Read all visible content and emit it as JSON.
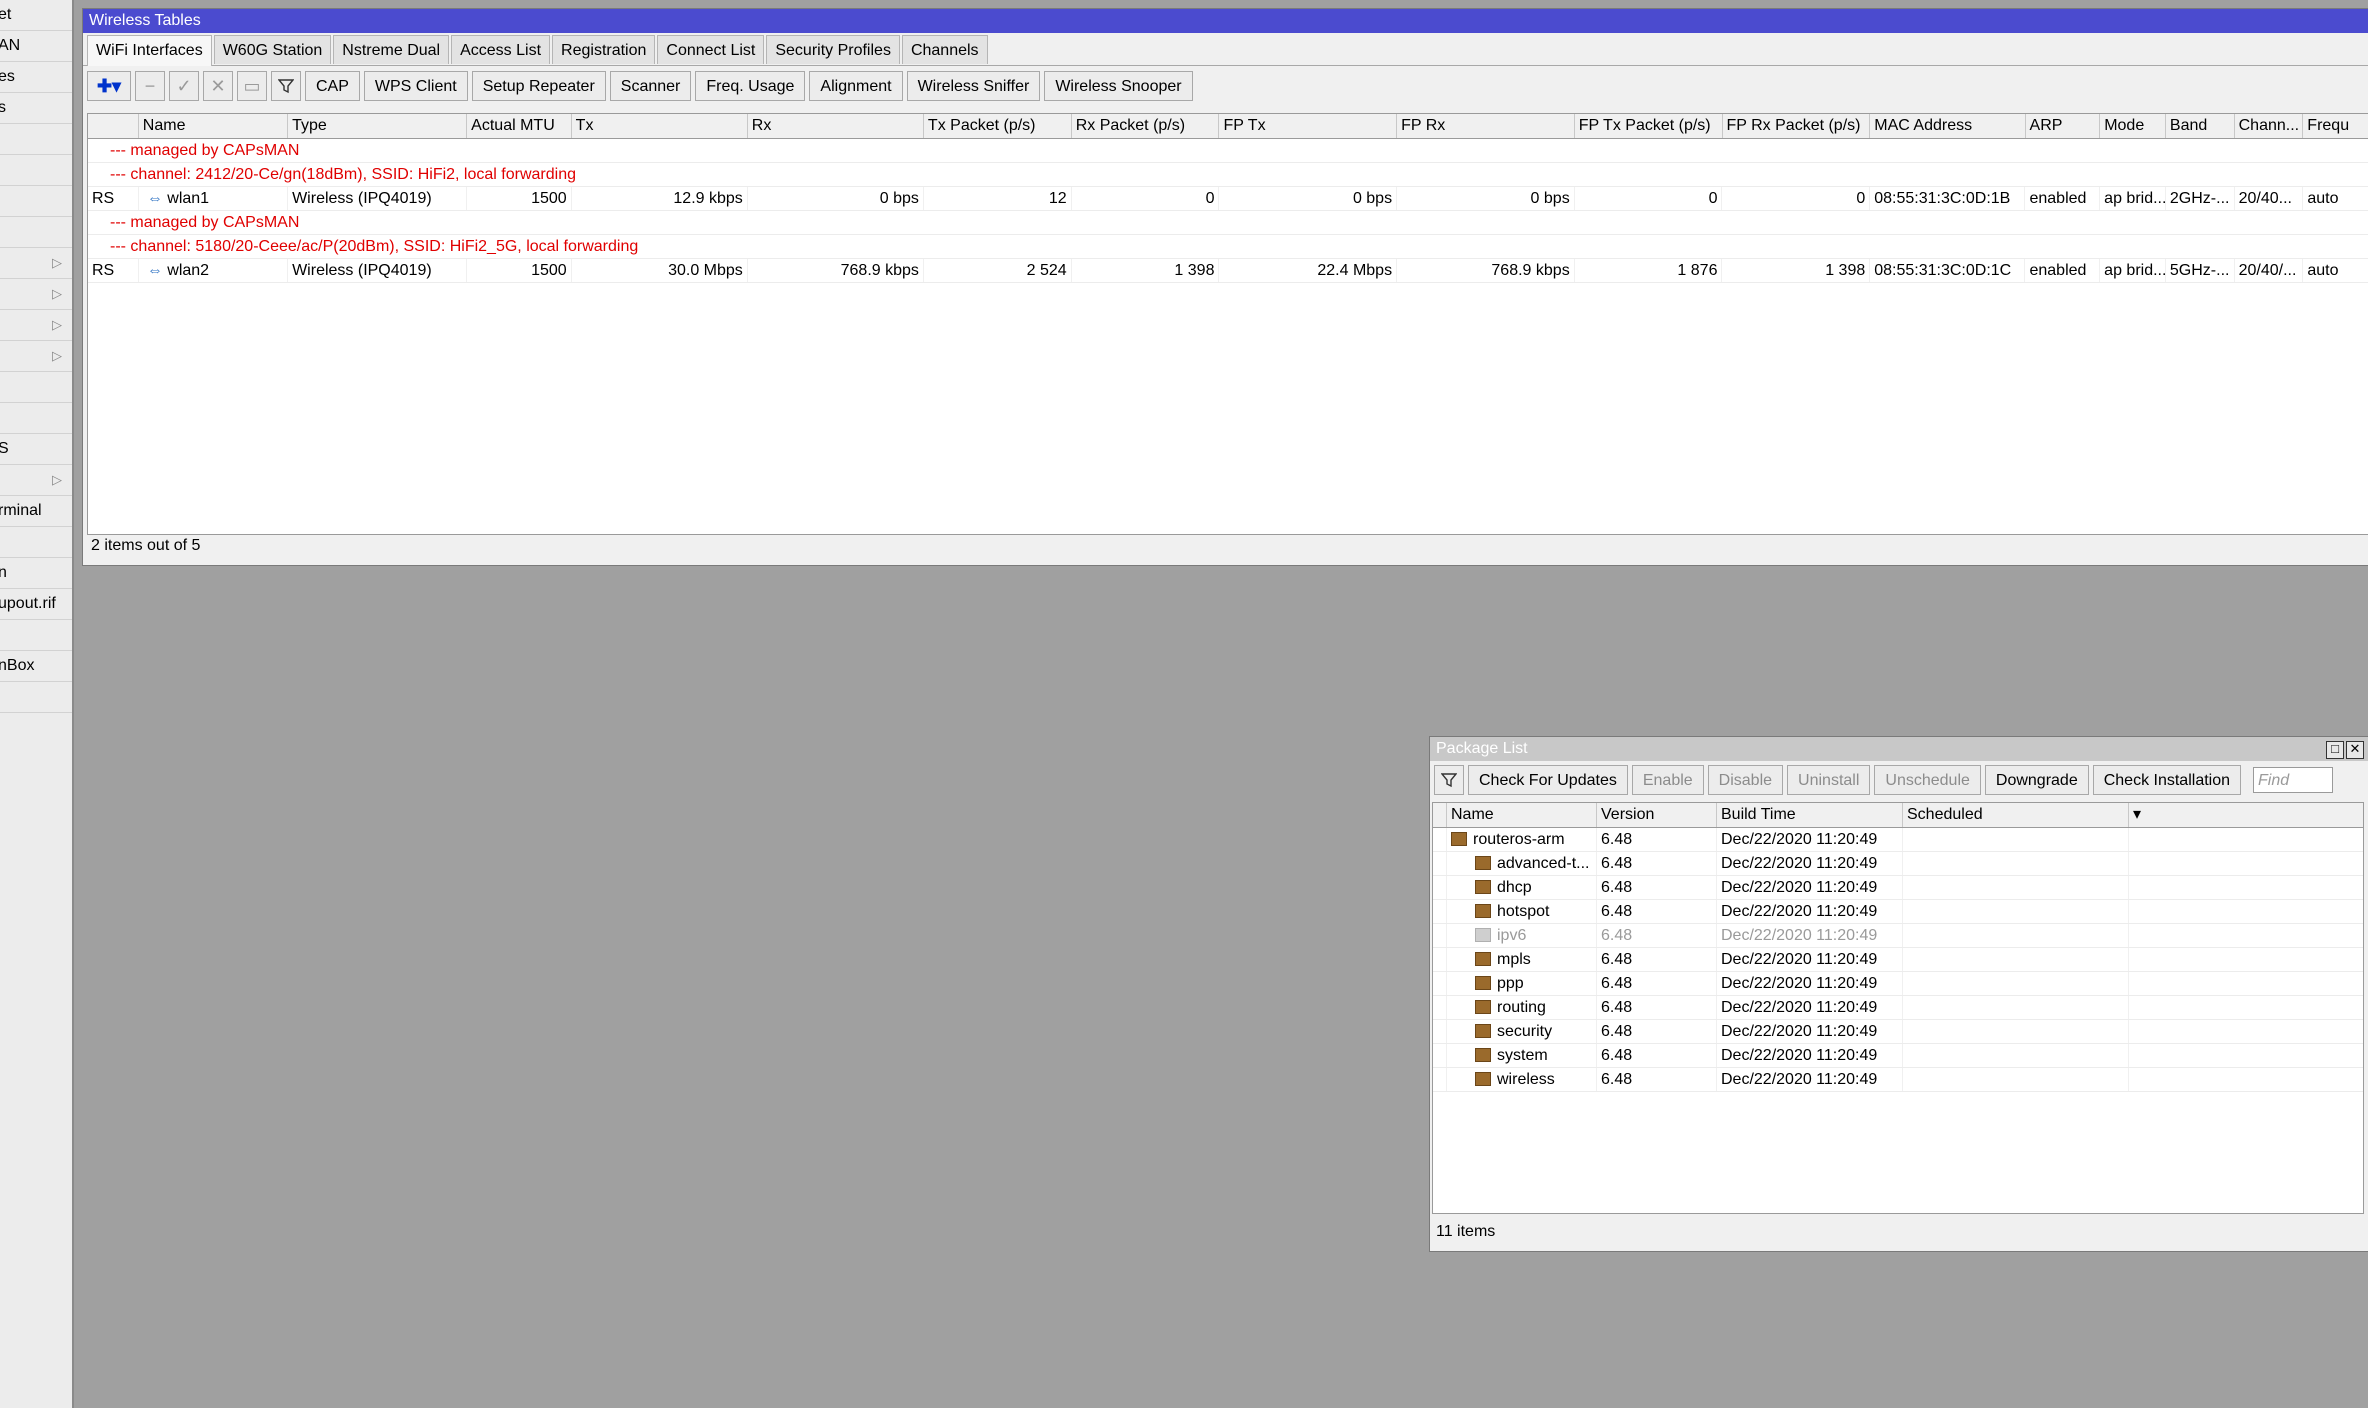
{
  "sidebar": {
    "items": [
      {
        "label": "et",
        "arrow": ""
      },
      {
        "label": "AN",
        "arrow": ""
      },
      {
        "label": "es",
        "arrow": ""
      },
      {
        "label": "s",
        "arrow": ""
      },
      {
        "label": "",
        "arrow": ""
      },
      {
        "label": "",
        "arrow": ""
      },
      {
        "label": "",
        "arrow": ""
      },
      {
        "label": "",
        "arrow": ""
      },
      {
        "label": "",
        "arrow": "▷"
      },
      {
        "label": "",
        "arrow": "▷"
      },
      {
        "label": "",
        "arrow": "▷"
      },
      {
        "label": "",
        "arrow": "▷"
      },
      {
        "label": "",
        "arrow": ""
      },
      {
        "label": "",
        "arrow": ""
      },
      {
        "label": "S",
        "arrow": ""
      },
      {
        "label": "",
        "arrow": "▷"
      },
      {
        "label": "rminal",
        "arrow": ""
      },
      {
        "label": "",
        "arrow": ""
      },
      {
        "label": "n",
        "arrow": ""
      },
      {
        "label": "upout.rif",
        "arrow": ""
      },
      {
        "label": "",
        "arrow": ""
      },
      {
        "label": "nBox",
        "arrow": ""
      },
      {
        "label": "",
        "arrow": ""
      }
    ]
  },
  "wireless": {
    "title": "Wireless Tables",
    "tabs": [
      "WiFi Interfaces",
      "W60G Station",
      "Nstreme Dual",
      "Access List",
      "Registration",
      "Connect List",
      "Security Profiles",
      "Channels"
    ],
    "toolbar_buttons": [
      "CAP",
      "WPS Client",
      "Setup Repeater",
      "Scanner",
      "Freq. Usage",
      "Alignment",
      "Wireless Sniffer",
      "Wireless Snooper"
    ],
    "columns": [
      "",
      "Name",
      "Type",
      "Actual MTU",
      "Tx",
      "Rx",
      "Tx Packet (p/s)",
      "Rx Packet (p/s)",
      "FP Tx",
      "FP Rx",
      "FP Tx Packet (p/s)",
      "FP Rx Packet (p/s)",
      "MAC Address",
      "ARP",
      "Mode",
      "Band",
      "Chann...",
      "Frequ"
    ],
    "entries": [
      {
        "comments": [
          "--- managed by CAPsMAN",
          "--- channel: 2412/20-Ce/gn(18dBm), SSID: HiFi2, local forwarding"
        ],
        "cells": [
          "RS",
          "wlan1",
          "Wireless (IPQ4019)",
          "1500",
          "12.9 kbps",
          "0 bps",
          "12",
          "0",
          "0 bps",
          "0 bps",
          "0",
          "0",
          "08:55:31:3C:0D:1B",
          "enabled",
          "ap brid...",
          "2GHz-...",
          "20/40...",
          "auto"
        ]
      },
      {
        "comments": [
          "--- managed by CAPsMAN",
          "--- channel: 5180/20-Ceee/ac/P(20dBm), SSID: HiFi2_5G, local forwarding"
        ],
        "cells": [
          "RS",
          "wlan2",
          "Wireless (IPQ4019)",
          "1500",
          "30.0 Mbps",
          "768.9 kbps",
          "2 524",
          "1 398",
          "22.4 Mbps",
          "768.9 kbps",
          "1 876",
          "1 398",
          "08:55:31:3C:0D:1C",
          "enabled",
          "ap brid...",
          "5GHz-...",
          "20/40/...",
          "auto"
        ]
      }
    ],
    "status": "2 items out of 5"
  },
  "packages": {
    "title": "Package List",
    "buttons": [
      "Check For Updates",
      "Enable",
      "Disable",
      "Uninstall",
      "Unschedule",
      "Downgrade",
      "Check Installation"
    ],
    "find_placeholder": "Find",
    "columns": [
      "Name",
      "Version",
      "Build Time",
      "Scheduled"
    ],
    "rows": [
      {
        "name": "routeros-arm",
        "version": "6.48",
        "build": "Dec/22/2020 11:20:49",
        "scheduled": "",
        "indent": false,
        "disabled": false
      },
      {
        "name": "advanced-t...",
        "version": "6.48",
        "build": "Dec/22/2020 11:20:49",
        "scheduled": "",
        "indent": true,
        "disabled": false
      },
      {
        "name": "dhcp",
        "version": "6.48",
        "build": "Dec/22/2020 11:20:49",
        "scheduled": "",
        "indent": true,
        "disabled": false
      },
      {
        "name": "hotspot",
        "version": "6.48",
        "build": "Dec/22/2020 11:20:49",
        "scheduled": "",
        "indent": true,
        "disabled": false
      },
      {
        "name": "ipv6",
        "version": "6.48",
        "build": "Dec/22/2020 11:20:49",
        "scheduled": "",
        "indent": true,
        "disabled": true
      },
      {
        "name": "mpls",
        "version": "6.48",
        "build": "Dec/22/2020 11:20:49",
        "scheduled": "",
        "indent": true,
        "disabled": false
      },
      {
        "name": "ppp",
        "version": "6.48",
        "build": "Dec/22/2020 11:20:49",
        "scheduled": "",
        "indent": true,
        "disabled": false
      },
      {
        "name": "routing",
        "version": "6.48",
        "build": "Dec/22/2020 11:20:49",
        "scheduled": "",
        "indent": true,
        "disabled": false
      },
      {
        "name": "security",
        "version": "6.48",
        "build": "Dec/22/2020 11:20:49",
        "scheduled": "",
        "indent": true,
        "disabled": false
      },
      {
        "name": "system",
        "version": "6.48",
        "build": "Dec/22/2020 11:20:49",
        "scheduled": "",
        "indent": true,
        "disabled": false
      },
      {
        "name": "wireless",
        "version": "6.48",
        "build": "Dec/22/2020 11:20:49",
        "scheduled": "",
        "indent": true,
        "disabled": false
      }
    ],
    "status": "11 items"
  }
}
